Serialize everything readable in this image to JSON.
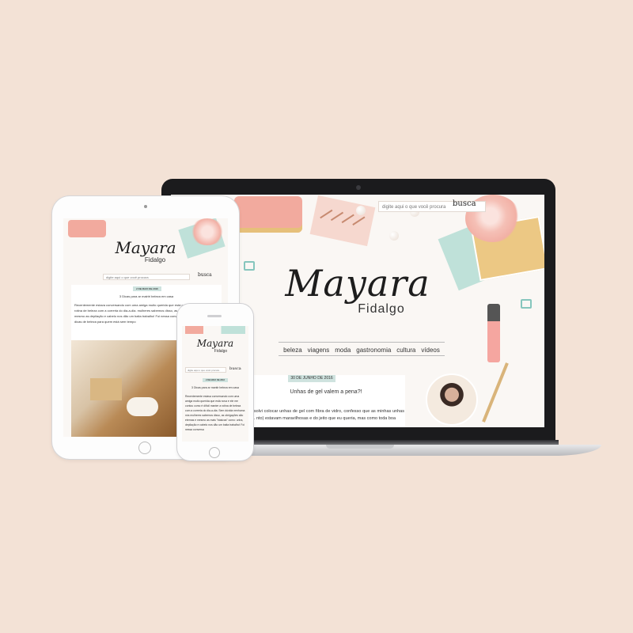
{
  "colors": {
    "background": "#f3e2d6",
    "accent_mint": "#cfe3df",
    "accent_pink": "#f2aa9e"
  },
  "site": {
    "logo_main": "Mayara",
    "logo_sub": "Fidalgo"
  },
  "laptop": {
    "search_placeholder": "digite aqui o que você procura",
    "search_button": "busca",
    "nav": [
      "beleza",
      "viagens",
      "moda",
      "gastronomia",
      "cultura",
      "vídeos"
    ],
    "post_date": "30 DE JUNHO DE 2016",
    "post_title": "Unhas de gel valem a pena?!",
    "post_excerpt": "resolvi colocar unhas de gel com fibra de vidro, confesso que as minhas unhas (... nto) estavam maravilhosas e do jeito que eu queria, mas como toda boa"
  },
  "tablet": {
    "search_placeholder": "digite aqui o que você procura",
    "search_button": "busca",
    "post_date": "2 DE MAIO DE 2016",
    "post_title": "3 Dicas para ar mairiri beleza em casa",
    "post_excerpt": "Recentemente estava conversando com uma amiga muito querida que está como é difícil manter a rotina de beleza com a correria do dia-a-dia. mulheres sabemos disso, as obrigações são eternas e mesmo as depilação e cabelo nos dão um baita trabalho! Foi nessa conversa pelé e resolvi trazer 3 dicas de beleza para quem está sem tempo"
  },
  "phone": {
    "search_placeholder": "digite aqui o que você procura",
    "search_button": "busca",
    "post_date": "2 DE MAIO DE 2016",
    "post_title": "3 Dicas para ar mantir beleza em casa",
    "post_excerpt": "Recentemente estava conversando com uma amiga muito querida que está nova e ele me contou como é difícil manter a rotina de beleza com a correria do dia-a-dia. Sem dúvida nenhuma nós mulheres sabemos disso, as obrigações são eternas e mesmo as mais \"básicas\" como: unha, depilação e cabelo nos dão um baita trabalho! Foi nessa conversa"
  }
}
